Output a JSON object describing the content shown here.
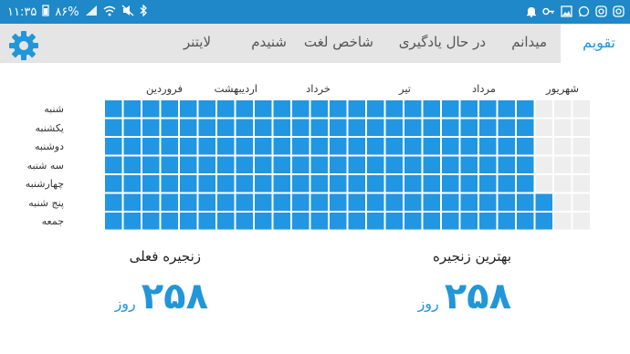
{
  "status_bar": {
    "time": "۱۱:۳۵",
    "battery": "۸۶%"
  },
  "tabs": [
    {
      "label": "تقویم",
      "active": true
    },
    {
      "label": "میدانم",
      "active": false
    },
    {
      "label": "در حال یادگیری",
      "active": false
    },
    {
      "label": "شاخص لغت",
      "active": false
    },
    {
      "label": "شنیدم",
      "active": false
    },
    {
      "label": "لایتنر",
      "active": false
    }
  ],
  "months": [
    "شهریور",
    "مرداد",
    "تیر",
    "خرداد",
    "اردیبهشت",
    "فروردین"
  ],
  "days": [
    "شنبه",
    "یکشنبه",
    "دوشنبه",
    "سه شنبه",
    "چهارشنبه",
    "پنج شنبه",
    "جمعه"
  ],
  "calendar_grid": {
    "columns": 26,
    "filled_columns": 23,
    "extra_filled_last_rows": 1,
    "colors": {
      "filled": "#2196e3",
      "empty": "#eeeeee"
    }
  },
  "best_streak": {
    "label": "بهترین زنجیره",
    "value": "۲۵۸",
    "unit": "روز"
  },
  "current_streak": {
    "label": "زنجیره فعلی",
    "value": "۲۵۸",
    "unit": "روز"
  },
  "colors": {
    "accent": "#2196d9",
    "status_bar": "#1e88c8"
  }
}
